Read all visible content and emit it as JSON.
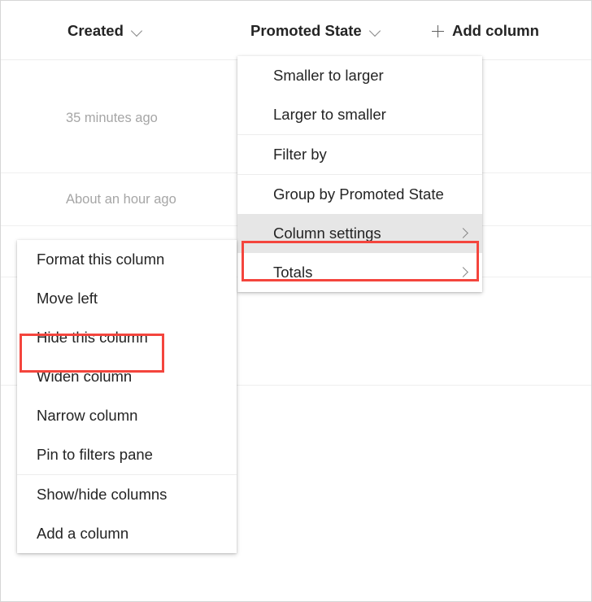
{
  "list_header": {
    "columns": [
      {
        "label": "Created",
        "icon": "chevron-down-icon"
      },
      {
        "label": "Promoted State",
        "icon": "chevron-down-icon"
      }
    ],
    "add_column_label": "Add column",
    "add_column_icon": "plus-icon"
  },
  "rows": [
    {
      "created": "35 minutes ago"
    },
    {
      "created": "About an hour ago"
    }
  ],
  "promoted_state_menu": {
    "items": [
      {
        "label": "Smaller to larger",
        "submenu": false
      },
      {
        "label": "Larger to smaller",
        "submenu": false
      },
      {
        "label": "Filter by",
        "submenu": false
      },
      {
        "label": "Group by Promoted State",
        "submenu": false
      },
      {
        "label": "Column settings",
        "submenu": true,
        "highlighted": true
      },
      {
        "label": "Totals",
        "submenu": true
      }
    ]
  },
  "created_menu": {
    "items": [
      {
        "label": "Format this column"
      },
      {
        "label": "Move left"
      },
      {
        "label": "Hide this column"
      },
      {
        "label": "Widen column"
      },
      {
        "label": "Narrow column"
      },
      {
        "label": "Pin to filters pane"
      },
      {
        "label": "Show/hide columns"
      },
      {
        "label": "Add a column"
      }
    ]
  },
  "annotations": {
    "highlight_color": "#f4453d",
    "boxes": [
      {
        "target": "Column settings"
      },
      {
        "target": "Hide this column"
      }
    ]
  },
  "submenu_icon": "chevron-right-icon"
}
